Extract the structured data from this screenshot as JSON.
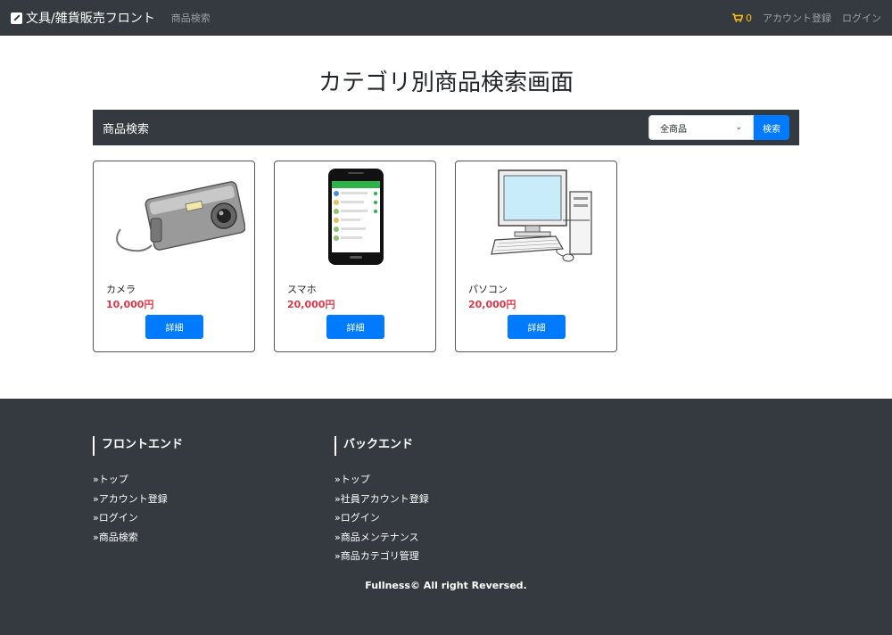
{
  "navbar": {
    "brand": "文具/雑貨販売フロント",
    "search_link": "商品検索",
    "cart_count": "0",
    "account_link": "アカウント登録",
    "login_link": "ログイン"
  },
  "main": {
    "title": "カテゴリ別商品検索画面",
    "search": {
      "title": "商品検索",
      "selected": "全商品",
      "button": "検索"
    },
    "products": [
      {
        "name": "カメラ",
        "price": "10,000円",
        "button": "詳細"
      },
      {
        "name": "スマホ",
        "price": "20,000円",
        "button": "詳細"
      },
      {
        "name": "パソコン",
        "price": "20,000円",
        "button": "詳細"
      }
    ]
  },
  "footer": {
    "front": {
      "heading": "フロントエンド",
      "links": [
        "»トップ",
        "»アカウント登録",
        "»ログイン",
        "»商品検索"
      ]
    },
    "back": {
      "heading": "バックエンド",
      "links": [
        "»トップ",
        "»社員アカウント登録",
        "»ログイン",
        "»商品メンテナンス",
        "»商品カテゴリ管理"
      ]
    },
    "copyright": "Fullness© All right Reversed."
  },
  "colors": {
    "navbar": "#343a40",
    "primary": "#007bff",
    "price": "#dc3545",
    "cart": "#ffc107"
  }
}
